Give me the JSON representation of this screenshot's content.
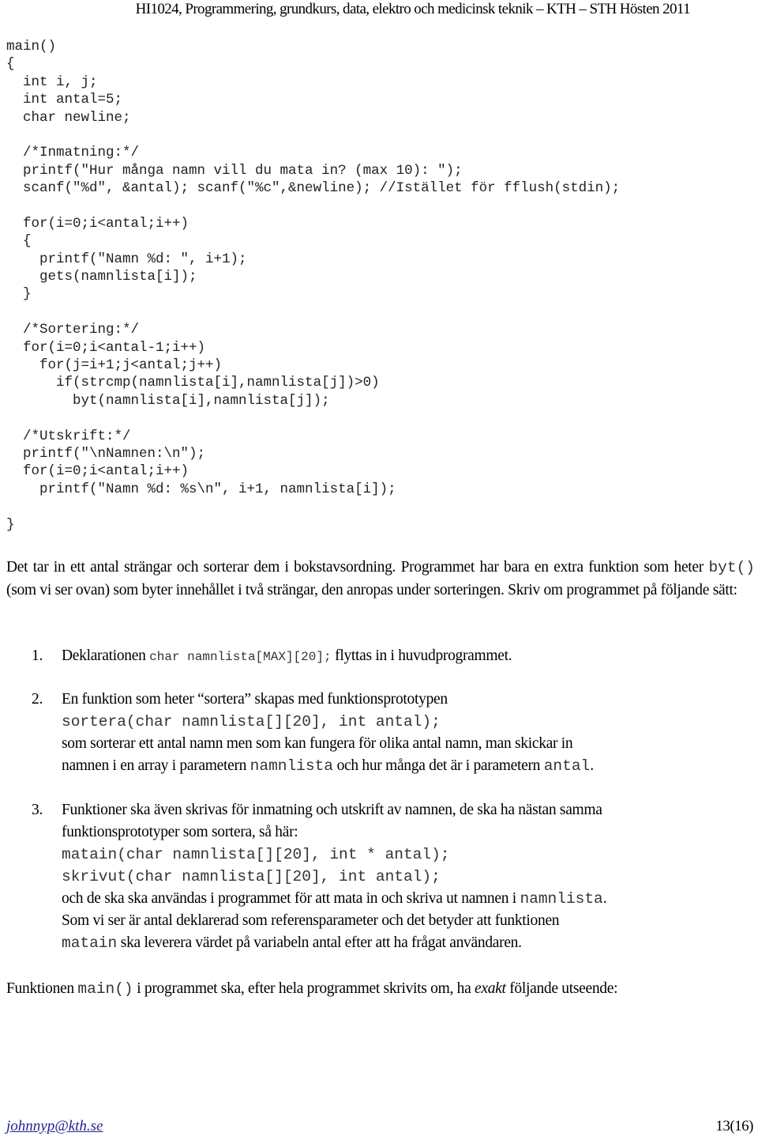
{
  "header": {
    "title": "HI1024, Programmering, grundkurs, data, elektro och medicinsk teknik – KTH – STH Hösten 2011"
  },
  "code": {
    "lines": [
      "main()",
      "{",
      "  int i, j;",
      "  int antal=5;",
      "  char newline;",
      "",
      "  /*Inmatning:*/",
      "  printf(\"Hur många namn vill du mata in? (max 10): \");",
      "  scanf(\"%d\", &antal); scanf(\"%c\",&newline); //Istället för fflush(stdin);",
      "",
      "  for(i=0;i<antal;i++)",
      "  {",
      "    printf(\"Namn %d: \", i+1);",
      "    gets(namnlista[i]);",
      "  }",
      "",
      "  /*Sortering:*/",
      "  for(i=0;i<antal-1;i++)",
      "    for(j=i+1;j<antal;j++)",
      "      if(strcmp(namnlista[i],namnlista[j])>0)",
      "        byt(namnlista[i],namnlista[j]);",
      "",
      "  /*Utskrift:*/",
      "  printf(\"\\nNamnen:\\n\");",
      "  for(i=0;i<antal;i++)",
      "    printf(\"Namn %d: %s\\n\", i+1, namnlista[i]);",
      "",
      "}"
    ]
  },
  "intro": {
    "part1": "Det tar in ett antal strängar och sorterar dem i bokstavsordning. Programmet har bara en extra funktion som heter ",
    "code1": "byt()",
    "part2": " (som vi ser ovan) som byter innehållet i två strängar, den anropas under sorteringen. Skriv om programmet på följande sätt:"
  },
  "list": [
    {
      "number": "1.",
      "text_before": "Deklarationen ",
      "code": "char namnlista[MAX][20];",
      "text_after": " flyttas in i huvudprogrammet."
    },
    {
      "number": "2.",
      "line1": "En funktion som heter “sortera” skapas med funktionsprototypen",
      "prototype": "sortera(char namnlista[][20], int antal);",
      "line3": "som sorterar ett antal namn men som kan fungera för olika antal namn, man skickar in",
      "line4_before": "namnen i en array i parametern ",
      "line4_code1": "namnlista",
      "line4_mid": " och hur många det är i parametern ",
      "line4_code2": "antal",
      "line4_end": "."
    },
    {
      "number": "3.",
      "line1": "Funktioner ska även skrivas för inmatning och utskrift av namnen, de ska ha nästan samma",
      "line2": "funktionsprototyper som sortera, så här:",
      "prototype1": "matain(char namnlista[][20], int * antal);",
      "prototype2": "skrivut(char namnlista[][20], int antal);",
      "line5_before": "och de ska ska användas i programmet för att mata in och skriva ut namnen i ",
      "line5_code": "namnlista",
      "line5_end": ".",
      "line6": "Som vi ser är antal deklarerad som referensparameter och det betyder att funktionen",
      "line7_code": "matain",
      "line7_after": " ska leverera värdet på variabeln antal efter att ha frågat användaren."
    }
  ],
  "outro": {
    "part1": "Funktionen ",
    "code": "main()",
    "part2": " i programmet ska, efter hela programmet skrivits om, ha ",
    "emphasis": "exakt",
    "part3": " följande utseende:"
  },
  "footer": {
    "email": "johnnyp@kth.se",
    "page": "13(16)"
  }
}
